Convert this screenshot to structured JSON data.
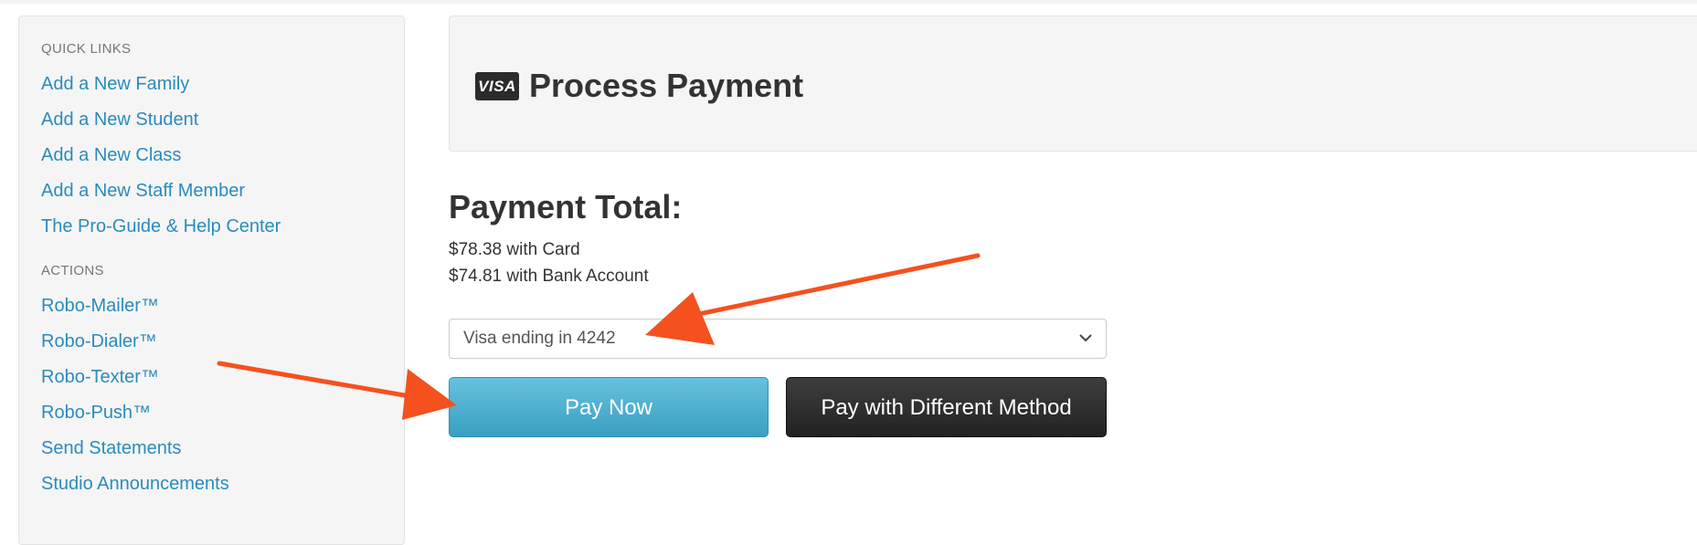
{
  "sidebar": {
    "quick_links_heading": "QUICK LINKS",
    "quick_links": [
      {
        "label": "Add a New Family"
      },
      {
        "label": "Add a New Student"
      },
      {
        "label": "Add a New Class"
      },
      {
        "label": "Add a New Staff Member"
      },
      {
        "label": "The Pro-Guide & Help Center"
      }
    ],
    "actions_heading": "ACTIONS",
    "actions": [
      {
        "label": "Robo-Mailer™"
      },
      {
        "label": "Robo-Dialer™"
      },
      {
        "label": "Robo-Texter™"
      },
      {
        "label": "Robo-Push™"
      },
      {
        "label": "Send Statements"
      },
      {
        "label": "Studio Announcements"
      }
    ]
  },
  "header": {
    "icon": "visa-card-icon",
    "icon_text": "VISA",
    "title": "Process Payment"
  },
  "payment": {
    "heading": "Payment Total:",
    "card_amount": "$78.38 with Card",
    "bank_amount": "$74.81 with Bank Account",
    "method_selected": "Visa ending in 4242",
    "method_chevron_icon": "chevron-down-icon"
  },
  "buttons": {
    "pay_now": "Pay Now",
    "pay_different": "Pay with Different Method"
  },
  "colors": {
    "link": "#2a8bbd",
    "pay_now_bg": "#4fb1d2",
    "pay_different_bg": "#2f2f2f",
    "annotation_arrow": "#f4511e"
  }
}
